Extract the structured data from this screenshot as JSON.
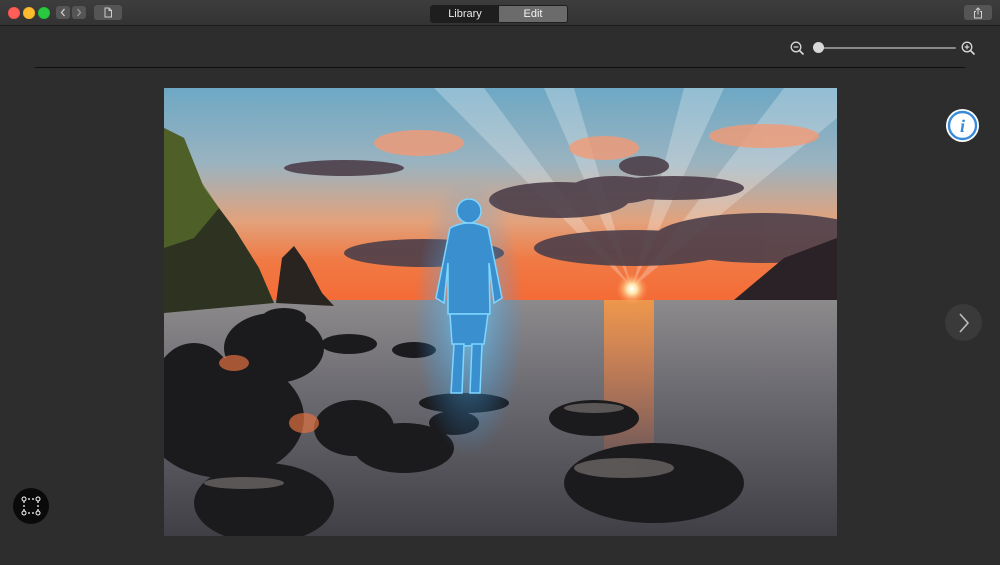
{
  "titlebar": {
    "tabs": [
      {
        "label": "Library",
        "selected": false
      },
      {
        "label": "Edit",
        "selected": true
      }
    ],
    "icons": {
      "back": "chevron-left-icon",
      "forward": "chevron-right-icon",
      "document": "document-icon",
      "share": "share-icon"
    }
  },
  "toolbar": {
    "zoom": {
      "out_icon": "zoom-out-icon",
      "in_icon": "zoom-in-icon",
      "level": 0.0
    }
  },
  "canvas": {
    "info_icon": "info-icon",
    "info_glyph": "i",
    "next_icon": "chevron-right-icon",
    "selection_icon": "selection-path-icon"
  },
  "colors": {
    "window_bg": "#2d2d2d",
    "info_accent": "#3a8ad8",
    "subject_highlight": "#4fb6ff"
  }
}
